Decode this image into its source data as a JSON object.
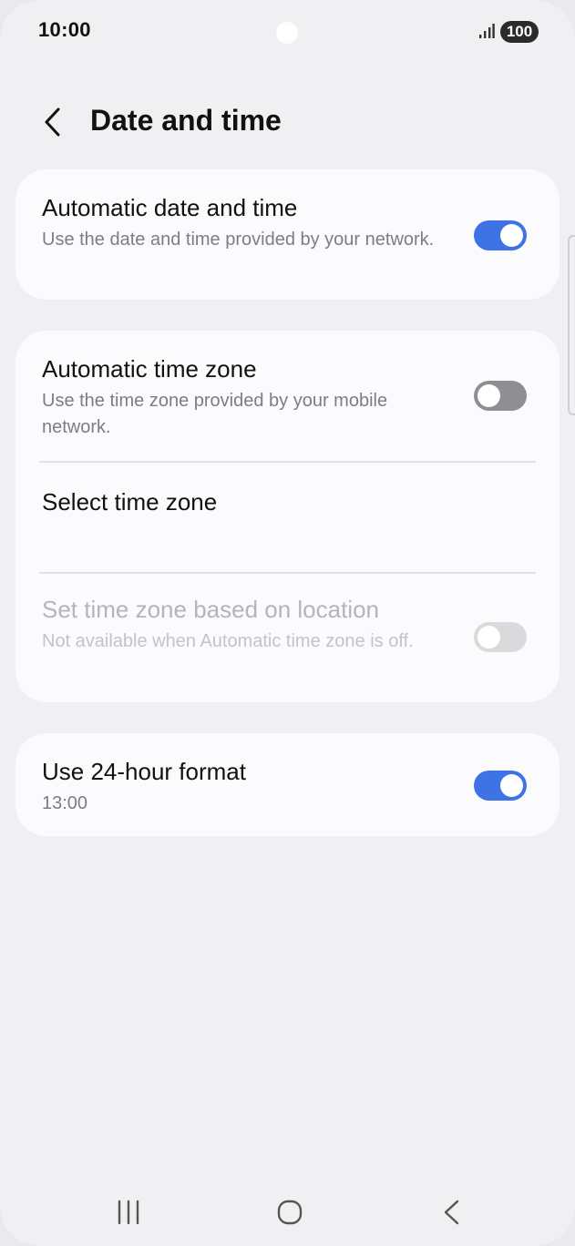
{
  "status_bar": {
    "time": "10:00",
    "battery": "100",
    "signal_icon": "signal-bars-icon"
  },
  "header": {
    "title": "Date and time",
    "back_icon": "back-arrow-icon"
  },
  "settings": {
    "automatic_date_time": {
      "title": "Automatic date and time",
      "description": "Use the date and time provided by your network.",
      "enabled": true
    },
    "automatic_time_zone": {
      "title": "Automatic time zone",
      "description": "Use the time zone provided by your mobile network.",
      "enabled": false
    },
    "select_time_zone": {
      "title": "Select time zone"
    },
    "time_zone_location": {
      "title": "Set time zone based on location",
      "description": "Not available when Automatic time zone is off.",
      "enabled": false,
      "available": false
    },
    "use_24_hour": {
      "title": "Use 24-hour format",
      "description": "13:00",
      "enabled": true
    }
  },
  "colors": {
    "accent": "#3e73e6",
    "background": "#f0f0f3",
    "card": "#fbfbfd"
  },
  "nav_bar": {
    "recents_icon": "recents-icon",
    "home_icon": "home-icon",
    "back_icon": "back-icon"
  }
}
